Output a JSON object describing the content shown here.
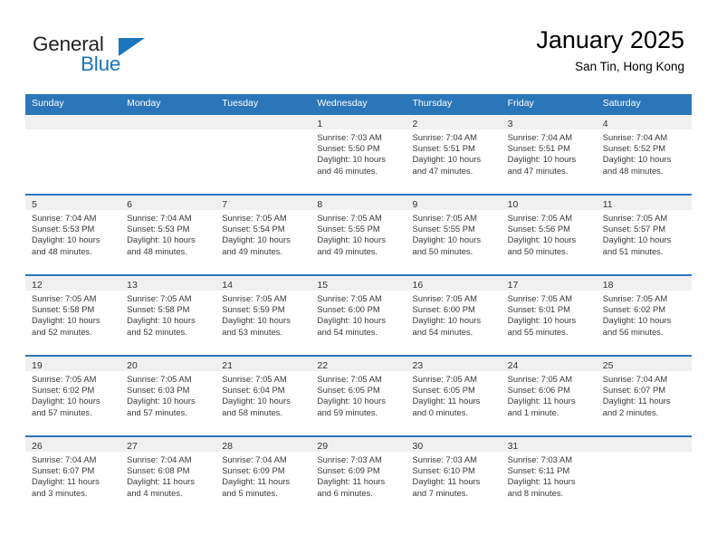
{
  "brand": {
    "name_part1": "General",
    "name_part2": "Blue",
    "accent_color": "#1b75bb"
  },
  "header": {
    "title": "January 2025",
    "location": "San Tin, Hong Kong"
  },
  "theme": {
    "header_blue": "#2b76b9",
    "daynum_band": "#f0f0f0",
    "text": "#3a3a3a"
  },
  "calendar": {
    "weekday_headers": [
      "Sunday",
      "Monday",
      "Tuesday",
      "Wednesday",
      "Thursday",
      "Friday",
      "Saturday"
    ],
    "weeks": [
      [
        {
          "day": "",
          "lines": []
        },
        {
          "day": "",
          "lines": []
        },
        {
          "day": "",
          "lines": []
        },
        {
          "day": "1",
          "lines": [
            "Sunrise: 7:03 AM",
            "Sunset: 5:50 PM",
            "Daylight: 10 hours",
            "and 46 minutes."
          ]
        },
        {
          "day": "2",
          "lines": [
            "Sunrise: 7:04 AM",
            "Sunset: 5:51 PM",
            "Daylight: 10 hours",
            "and 47 minutes."
          ]
        },
        {
          "day": "3",
          "lines": [
            "Sunrise: 7:04 AM",
            "Sunset: 5:51 PM",
            "Daylight: 10 hours",
            "and 47 minutes."
          ]
        },
        {
          "day": "4",
          "lines": [
            "Sunrise: 7:04 AM",
            "Sunset: 5:52 PM",
            "Daylight: 10 hours",
            "and 48 minutes."
          ]
        }
      ],
      [
        {
          "day": "5",
          "lines": [
            "Sunrise: 7:04 AM",
            "Sunset: 5:53 PM",
            "Daylight: 10 hours",
            "and 48 minutes."
          ]
        },
        {
          "day": "6",
          "lines": [
            "Sunrise: 7:04 AM",
            "Sunset: 5:53 PM",
            "Daylight: 10 hours",
            "and 48 minutes."
          ]
        },
        {
          "day": "7",
          "lines": [
            "Sunrise: 7:05 AM",
            "Sunset: 5:54 PM",
            "Daylight: 10 hours",
            "and 49 minutes."
          ]
        },
        {
          "day": "8",
          "lines": [
            "Sunrise: 7:05 AM",
            "Sunset: 5:55 PM",
            "Daylight: 10 hours",
            "and 49 minutes."
          ]
        },
        {
          "day": "9",
          "lines": [
            "Sunrise: 7:05 AM",
            "Sunset: 5:55 PM",
            "Daylight: 10 hours",
            "and 50 minutes."
          ]
        },
        {
          "day": "10",
          "lines": [
            "Sunrise: 7:05 AM",
            "Sunset: 5:56 PM",
            "Daylight: 10 hours",
            "and 50 minutes."
          ]
        },
        {
          "day": "11",
          "lines": [
            "Sunrise: 7:05 AM",
            "Sunset: 5:57 PM",
            "Daylight: 10 hours",
            "and 51 minutes."
          ]
        }
      ],
      [
        {
          "day": "12",
          "lines": [
            "Sunrise: 7:05 AM",
            "Sunset: 5:58 PM",
            "Daylight: 10 hours",
            "and 52 minutes."
          ]
        },
        {
          "day": "13",
          "lines": [
            "Sunrise: 7:05 AM",
            "Sunset: 5:58 PM",
            "Daylight: 10 hours",
            "and 52 minutes."
          ]
        },
        {
          "day": "14",
          "lines": [
            "Sunrise: 7:05 AM",
            "Sunset: 5:59 PM",
            "Daylight: 10 hours",
            "and 53 minutes."
          ]
        },
        {
          "day": "15",
          "lines": [
            "Sunrise: 7:05 AM",
            "Sunset: 6:00 PM",
            "Daylight: 10 hours",
            "and 54 minutes."
          ]
        },
        {
          "day": "16",
          "lines": [
            "Sunrise: 7:05 AM",
            "Sunset: 6:00 PM",
            "Daylight: 10 hours",
            "and 54 minutes."
          ]
        },
        {
          "day": "17",
          "lines": [
            "Sunrise: 7:05 AM",
            "Sunset: 6:01 PM",
            "Daylight: 10 hours",
            "and 55 minutes."
          ]
        },
        {
          "day": "18",
          "lines": [
            "Sunrise: 7:05 AM",
            "Sunset: 6:02 PM",
            "Daylight: 10 hours",
            "and 56 minutes."
          ]
        }
      ],
      [
        {
          "day": "19",
          "lines": [
            "Sunrise: 7:05 AM",
            "Sunset: 6:02 PM",
            "Daylight: 10 hours",
            "and 57 minutes."
          ]
        },
        {
          "day": "20",
          "lines": [
            "Sunrise: 7:05 AM",
            "Sunset: 6:03 PM",
            "Daylight: 10 hours",
            "and 57 minutes."
          ]
        },
        {
          "day": "21",
          "lines": [
            "Sunrise: 7:05 AM",
            "Sunset: 6:04 PM",
            "Daylight: 10 hours",
            "and 58 minutes."
          ]
        },
        {
          "day": "22",
          "lines": [
            "Sunrise: 7:05 AM",
            "Sunset: 6:05 PM",
            "Daylight: 10 hours",
            "and 59 minutes."
          ]
        },
        {
          "day": "23",
          "lines": [
            "Sunrise: 7:05 AM",
            "Sunset: 6:05 PM",
            "Daylight: 11 hours",
            "and 0 minutes."
          ]
        },
        {
          "day": "24",
          "lines": [
            "Sunrise: 7:05 AM",
            "Sunset: 6:06 PM",
            "Daylight: 11 hours",
            "and 1 minute."
          ]
        },
        {
          "day": "25",
          "lines": [
            "Sunrise: 7:04 AM",
            "Sunset: 6:07 PM",
            "Daylight: 11 hours",
            "and 2 minutes."
          ]
        }
      ],
      [
        {
          "day": "26",
          "lines": [
            "Sunrise: 7:04 AM",
            "Sunset: 6:07 PM",
            "Daylight: 11 hours",
            "and 3 minutes."
          ]
        },
        {
          "day": "27",
          "lines": [
            "Sunrise: 7:04 AM",
            "Sunset: 6:08 PM",
            "Daylight: 11 hours",
            "and 4 minutes."
          ]
        },
        {
          "day": "28",
          "lines": [
            "Sunrise: 7:04 AM",
            "Sunset: 6:09 PM",
            "Daylight: 11 hours",
            "and 5 minutes."
          ]
        },
        {
          "day": "29",
          "lines": [
            "Sunrise: 7:03 AM",
            "Sunset: 6:09 PM",
            "Daylight: 11 hours",
            "and 6 minutes."
          ]
        },
        {
          "day": "30",
          "lines": [
            "Sunrise: 7:03 AM",
            "Sunset: 6:10 PM",
            "Daylight: 11 hours",
            "and 7 minutes."
          ]
        },
        {
          "day": "31",
          "lines": [
            "Sunrise: 7:03 AM",
            "Sunset: 6:11 PM",
            "Daylight: 11 hours",
            "and 8 minutes."
          ]
        },
        {
          "day": "",
          "lines": []
        }
      ]
    ]
  }
}
